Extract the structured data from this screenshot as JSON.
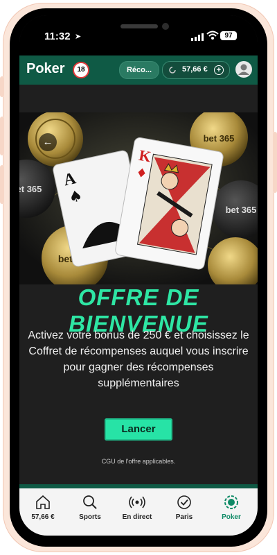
{
  "status_bar": {
    "time": "11:32",
    "battery": "97"
  },
  "header": {
    "brand": "Poker",
    "age_badge": "18",
    "recommend_label": "Réco...",
    "balance": "57,66 €"
  },
  "offer": {
    "title": "OFFRE DE BIENVENUE",
    "description": "Activez votre bonus de 250 € et choisissez le Coffret de récompenses auquel vous inscrire pour gagner des récompenses supplémentaires",
    "launch_label": "Lancer",
    "terms": "CGU de l'offre applicables."
  },
  "banner": {
    "chip_brand": "bet 365"
  },
  "nav": {
    "items": [
      {
        "label": "57,66 €",
        "icon": "home-icon"
      },
      {
        "label": "Sports",
        "icon": "search-icon"
      },
      {
        "label": "En direct",
        "icon": "live-icon"
      },
      {
        "label": "Paris",
        "icon": "check-icon"
      },
      {
        "label": "Poker",
        "icon": "poker-icon"
      }
    ],
    "active_color": "#0f8a66"
  },
  "colors": {
    "accent": "#27e3a6",
    "header": "#0f5a45"
  }
}
